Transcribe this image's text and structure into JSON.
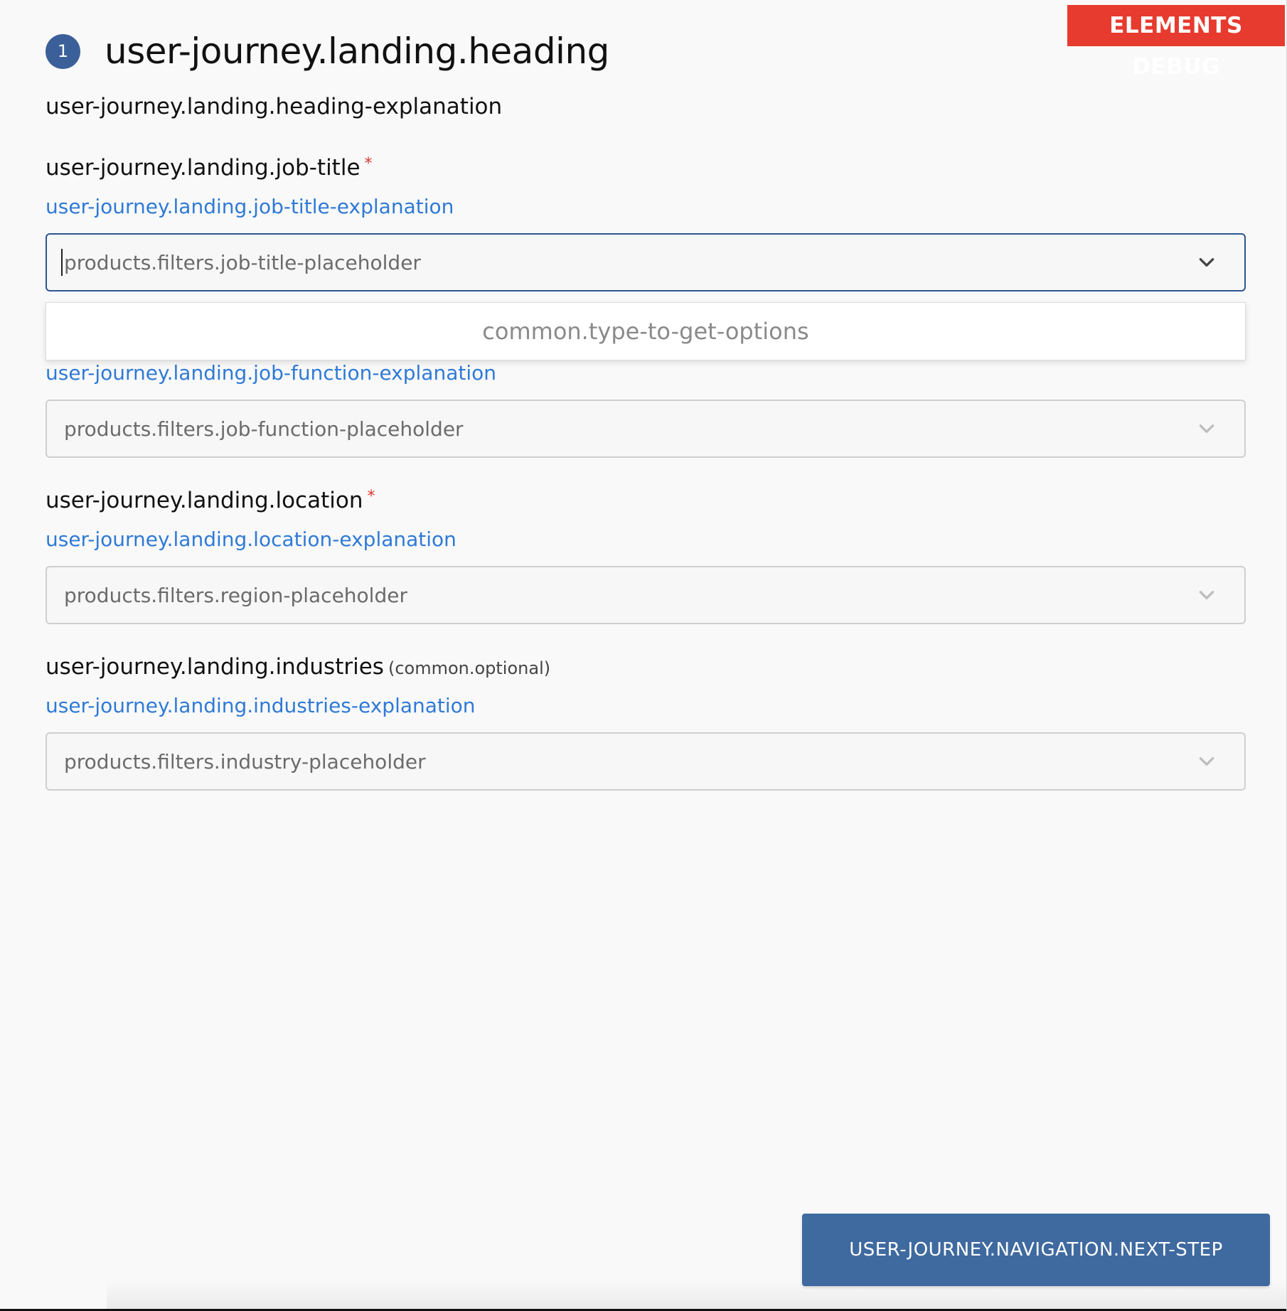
{
  "debug_badge": "ELEMENTS DEBUG",
  "step": {
    "number": "1",
    "heading": "user-journey.landing.heading",
    "explanation": "user-journey.landing.heading-explanation"
  },
  "fields": {
    "job_title": {
      "label": "user-journey.landing.job-title",
      "required_mark": "*",
      "explanation": "user-journey.landing.job-title-explanation",
      "placeholder": "products.filters.job-title-placeholder",
      "dropdown_message": "common.type-to-get-options"
    },
    "job_function": {
      "explanation": "user-journey.landing.job-function-explanation",
      "placeholder": "products.filters.job-function-placeholder"
    },
    "location": {
      "label": "user-journey.landing.location",
      "required_mark": "*",
      "explanation": "user-journey.landing.location-explanation",
      "placeholder": "products.filters.region-placeholder"
    },
    "industries": {
      "label": "user-journey.landing.industries",
      "optional_mark": "(common.optional)",
      "explanation": "user-journey.landing.industries-explanation",
      "placeholder": "products.filters.industry-placeholder"
    }
  },
  "navigation": {
    "next_label": "USER-JOURNEY.NAVIGATION.NEXT-STEP"
  },
  "colors": {
    "accent": "#3b6099",
    "link": "#2f7ad6",
    "required": "#d9362b",
    "debug_badge": "#e63b2e",
    "button": "#3f6aa0"
  }
}
